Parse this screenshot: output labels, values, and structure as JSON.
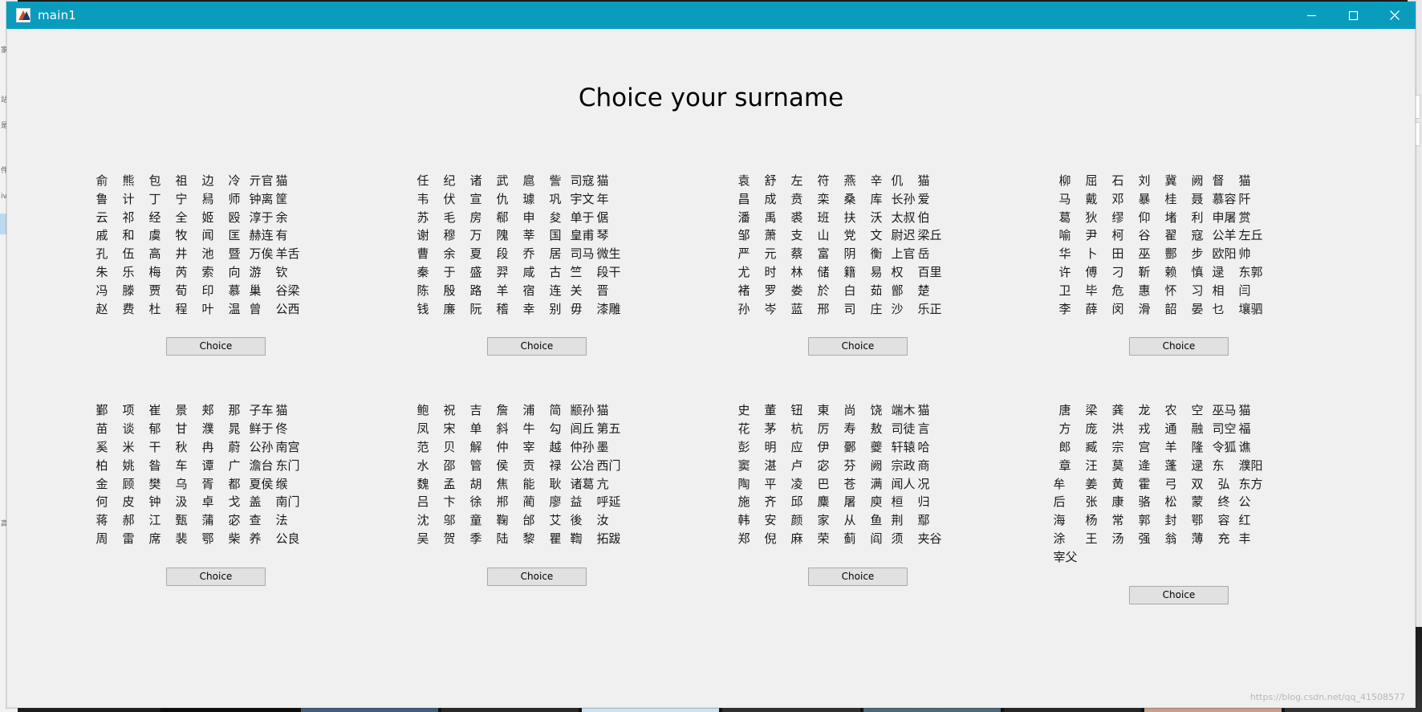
{
  "window": {
    "title": "main1",
    "icon": "matlab-icon",
    "controls": {
      "minimize": "minimize-icon",
      "maximize": "maximize-icon",
      "close": "close-icon"
    }
  },
  "page": {
    "heading": "Choice your surname",
    "watermark": "https://blog.csdn.net/qq_41508577"
  },
  "button_label": "Choice",
  "panels": [
    {
      "id": "panel-1",
      "rows": [
        [
          "俞",
          "熊",
          "包",
          "祖",
          "边",
          "冷",
          "亓官",
          "猫"
        ],
        [
          "鲁",
          "计",
          "丁",
          "宁",
          "舄",
          "师",
          "钟离",
          "筐"
        ],
        [
          "云",
          "祁",
          "经",
          "全",
          "姬",
          "殴",
          "淳于",
          "余"
        ],
        [
          "戚",
          "和",
          "虞",
          "牧",
          "闻",
          "匡",
          "赫连",
          "有"
        ],
        [
          "孔",
          "伍",
          "高",
          "井",
          "池",
          "暨",
          "万俟",
          "羊舌"
        ],
        [
          "朱",
          "乐",
          "梅",
          "芮",
          "索",
          "向",
          "游",
          "钦"
        ],
        [
          "冯",
          "滕",
          "贾",
          "荀",
          "印",
          "慕",
          "巢",
          "谷梁"
        ],
        [
          "赵",
          "费",
          "杜",
          "程",
          "叶",
          "温",
          "曾",
          "公西"
        ]
      ]
    },
    {
      "id": "panel-2",
      "rows": [
        [
          "任",
          "纪",
          "诸",
          "武",
          "扈",
          "訾",
          "司寇",
          "猫"
        ],
        [
          "韦",
          "伏",
          "宣",
          "仇",
          "璩",
          "巩",
          "宇文",
          "年"
        ],
        [
          "苏",
          "毛",
          "房",
          "郗",
          "申",
          "夋",
          "单于",
          "倨"
        ],
        [
          "谢",
          "穆",
          "万",
          "隗",
          "莘",
          "国",
          "皇甫",
          "琴"
        ],
        [
          "曹",
          "余",
          "夏",
          "段",
          "乔",
          "居",
          "司马",
          "微生"
        ],
        [
          "秦",
          "于",
          "盛",
          "羿",
          "咸",
          "古",
          "竺",
          "段干"
        ],
        [
          "陈",
          "殷",
          "路",
          "羊",
          "宿",
          "连",
          "关",
          "晋"
        ],
        [
          "钱",
          "廉",
          "阮",
          "稽",
          "幸",
          "别",
          "毋",
          "漆雕"
        ]
      ]
    },
    {
      "id": "panel-3",
      "rows": [
        [
          "袁",
          "舒",
          "左",
          "符",
          "燕",
          "辛",
          "仉",
          "猫"
        ],
        [
          "昌",
          "成",
          "贲",
          "栾",
          "桑",
          "库",
          "长孙",
          "爱"
        ],
        [
          "潘",
          "禹",
          "裘",
          "班",
          "扶",
          "沃",
          "太叔",
          "伯"
        ],
        [
          "邹",
          "萧",
          "支",
          "山",
          "党",
          "文",
          "尉迟",
          "梁丘"
        ],
        [
          "严",
          "元",
          "蔡",
          "富",
          "阴",
          "衡",
          "上官",
          "岳"
        ],
        [
          "尤",
          "时",
          "林",
          "储",
          "籍",
          "易",
          "权",
          "百里"
        ],
        [
          "褚",
          "罗",
          "娄",
          "於",
          "白",
          "茹",
          "鄫",
          "楚"
        ],
        [
          "孙",
          "岑",
          "蓝",
          "邢",
          "司",
          "庄",
          "沙",
          "乐正"
        ]
      ]
    },
    {
      "id": "panel-4",
      "rows": [
        [
          "柳",
          "屈",
          "石",
          "刘",
          "冀",
          "阙",
          "督",
          "猫"
        ],
        [
          "马",
          "戴",
          "邓",
          "暴",
          "桂",
          "聂",
          "慕容",
          "阡"
        ],
        [
          "葛",
          "狄",
          "缪",
          "仰",
          "堵",
          "利",
          "申屠",
          "赏"
        ],
        [
          "喻",
          "尹",
          "柯",
          "谷",
          "翟",
          "寇",
          "公羊",
          "左丘"
        ],
        [
          "华",
          "卜",
          "田",
          "巫",
          "酆",
          "步",
          "欧阳",
          "帅"
        ],
        [
          "许",
          "傅",
          "刁",
          "靳",
          "赖",
          "慎",
          "逯",
          "东郭"
        ],
        [
          "卫",
          "毕",
          "危",
          "惠",
          "怀",
          "习",
          "相",
          "闫"
        ],
        [
          "李",
          "薛",
          "闵",
          "滑",
          "韶",
          "晏",
          "乜",
          "壤驷"
        ]
      ]
    },
    {
      "id": "panel-5",
      "rows": [
        [
          "鄞",
          "项",
          "崔",
          "景",
          "郏",
          "那",
          "子车",
          "猫"
        ],
        [
          "苗",
          "谈",
          "郁",
          "甘",
          "濮",
          "晁",
          "鲜于",
          "佟"
        ],
        [
          "奚",
          "米",
          "干",
          "秋",
          "冉",
          "蔚",
          "公孙",
          "南宫"
        ],
        [
          "柏",
          "姚",
          "昝",
          "车",
          "谭",
          "广",
          "澹台",
          "东门"
        ],
        [
          "金",
          "顾",
          "樊",
          "乌",
          "胥",
          "都",
          "夏侯",
          "缑"
        ],
        [
          "何",
          "皮",
          "钟",
          "汲",
          "卓",
          "戈",
          "盖",
          "南门"
        ],
        [
          "蒋",
          "郝",
          "江",
          "甄",
          "蒲",
          "宓",
          "查",
          "法"
        ],
        [
          "周",
          "雷",
          "席",
          "裴",
          "鄂",
          "柴",
          "养",
          "公良"
        ]
      ]
    },
    {
      "id": "panel-6",
      "rows": [
        [
          "鲍",
          "祝",
          "吉",
          "詹",
          "浦",
          "简",
          "颛孙",
          "猫"
        ],
        [
          "凤",
          "宋",
          "单",
          "斜",
          "牛",
          "勾",
          "闾丘",
          "第五"
        ],
        [
          "范",
          "贝",
          "解",
          "仲",
          "宰",
          "越",
          "仲孙",
          "墨"
        ],
        [
          "水",
          "邵",
          "管",
          "侯",
          "贡",
          "禄",
          "公冶",
          "西门"
        ],
        [
          "魏",
          "孟",
          "胡",
          "焦",
          "能",
          "耿",
          "诸葛",
          "亢"
        ],
        [
          "吕",
          "卞",
          "徐",
          "郱",
          "蔺",
          "廖",
          "益",
          "呼延"
        ],
        [
          "沈",
          "邬",
          "童",
          "鞠",
          "邰",
          "艾",
          "後",
          "汝"
        ],
        [
          "吴",
          "贺",
          "季",
          "陆",
          "黎",
          "瞿",
          "鞫",
          "拓跋"
        ]
      ]
    },
    {
      "id": "panel-7",
      "rows": [
        [
          "史",
          "董",
          "钮",
          "東",
          "尚",
          "饶",
          "端木",
          "猫"
        ],
        [
          "花",
          "茅",
          "杭",
          "厉",
          "寿",
          "敖",
          "司徒",
          "言"
        ],
        [
          "彭",
          "明",
          "应",
          "伊",
          "鄾",
          "夔",
          "轩辕",
          "哈"
        ],
        [
          "窦",
          "湛",
          "卢",
          "宓",
          "芬",
          "阙",
          "宗政",
          "商"
        ],
        [
          "陶",
          "平",
          "凌",
          "巴",
          "苍",
          "满",
          "闻人",
          "况"
        ],
        [
          "施",
          "齐",
          "邱",
          "麋",
          "屠",
          "庾",
          "桓",
          "归"
        ],
        [
          "韩",
          "安",
          "颜",
          "家",
          "从",
          "鱼",
          "荆",
          "鄢"
        ],
        [
          "郑",
          "倪",
          "麻",
          "荣",
          "蓟",
          "阎",
          "须",
          "夹谷"
        ]
      ]
    },
    {
      "id": "panel-8",
      "rows": [
        [
          "唐",
          "梁",
          "龚",
          "龙",
          "农",
          "空",
          "巫马",
          "猫"
        ],
        [
          "方",
          "庞",
          "洪",
          "戎",
          "通",
          "融",
          "司空",
          "福"
        ],
        [
          "郎",
          "臧",
          "宗",
          "宫",
          "羊",
          "隆",
          "令狐",
          "谯"
        ],
        [
          "章",
          "汪",
          "莫",
          "逄",
          "蓬",
          "逯",
          "东",
          "濮阳",
          "牟"
        ],
        [
          "姜",
          "黄",
          "霍",
          "弓",
          "双",
          "弘",
          "东方",
          "后"
        ],
        [
          "张",
          "康",
          "骆",
          "松",
          "蒙",
          "终",
          "公",
          "海"
        ],
        [
          "杨",
          "常",
          "郭",
          "封",
          "鄂",
          "容",
          "红",
          "涂"
        ],
        [
          "王",
          "汤",
          "强",
          "翁",
          "薄",
          "充",
          "丰",
          "宰父"
        ]
      ]
    }
  ],
  "colors": {
    "titlebar": "#0a9cbd",
    "client_bg": "#f0f0f0",
    "button_bg": "#e1e1e1",
    "text": "#1a1a1a"
  },
  "desktop": {
    "left_ticks": [
      "家",
      "站",
      "是",
      "件",
      "iv",
      "高"
    ]
  }
}
